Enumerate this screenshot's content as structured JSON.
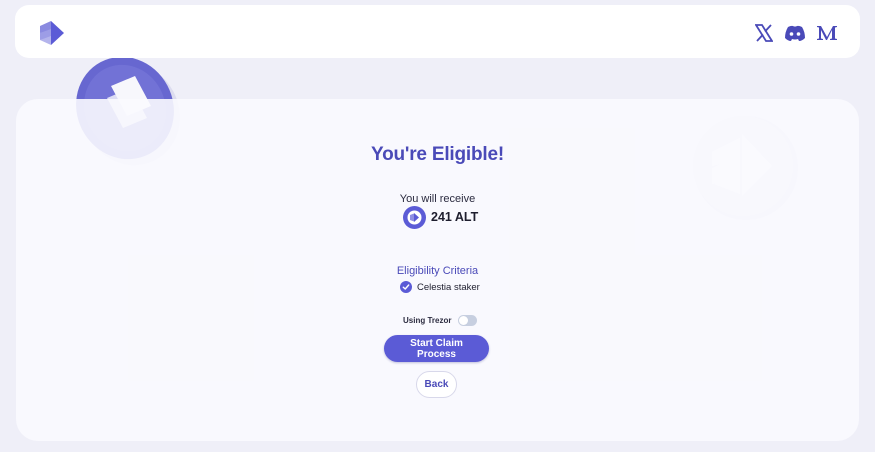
{
  "header": {
    "logo_icon": "altlayer-logo-icon",
    "social": [
      {
        "icon": "x-twitter-icon"
      },
      {
        "icon": "discord-icon"
      },
      {
        "icon": "medium-icon"
      }
    ]
  },
  "main": {
    "title": "You're Eligible!",
    "receive_label": "You will receive",
    "amount": "241 ALT",
    "token_icon": "alt-token-icon",
    "criteria_title": "Eligibility Criteria",
    "criteria_items": [
      {
        "label": "Celestia staker",
        "icon": "check-circle-icon"
      }
    ],
    "trezor_label": "Using Trezor",
    "trezor_enabled": false,
    "start_button": "Start Claim Process",
    "back_button": "Back"
  },
  "colors": {
    "accent": "#5b5bd6",
    "title": "#4a4ab8",
    "background": "#efeff8"
  }
}
